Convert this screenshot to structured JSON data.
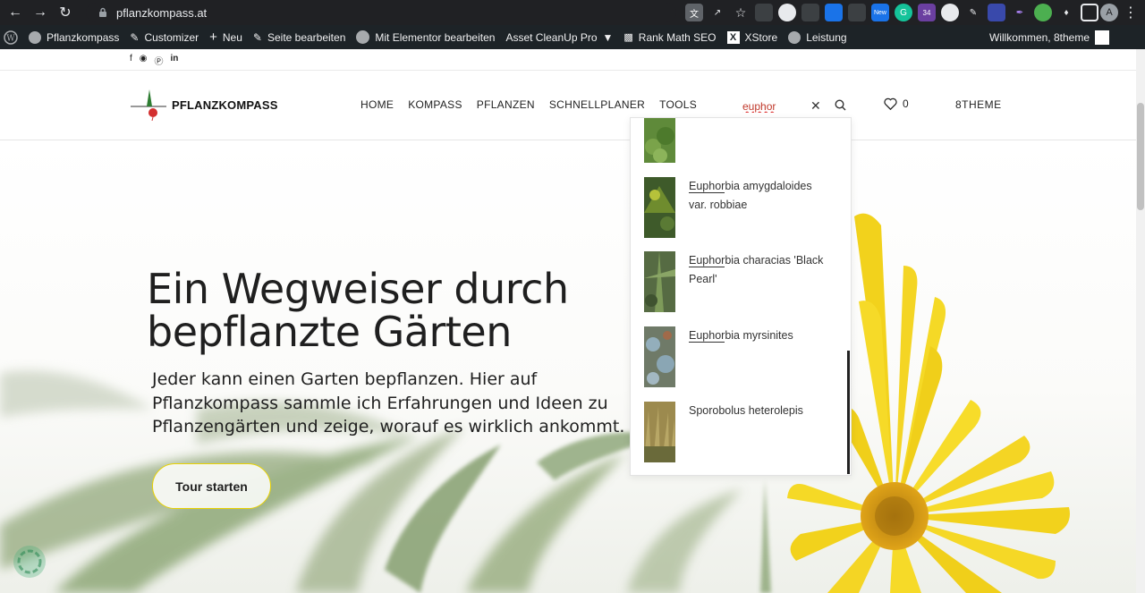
{
  "browser": {
    "url": "pflanzkompass.at",
    "profile_initial": "A",
    "ext_badge_new": "New",
    "ext_badge_count": "34"
  },
  "admin_bar": {
    "items": [
      {
        "label": "Pflanzkompass",
        "icon": "home-icon"
      },
      {
        "label": "Customizer",
        "icon": "brush-icon"
      },
      {
        "label": "Neu",
        "icon": "plus-icon"
      },
      {
        "label": "Seite bearbeiten",
        "icon": "pencil-icon"
      },
      {
        "label": "Mit Elementor bearbeiten",
        "icon": "elementor-icon"
      },
      {
        "label": "Asset CleanUp Pro",
        "icon": "funnel-icon"
      },
      {
        "label": "Rank Math SEO",
        "icon": "chart-icon"
      },
      {
        "label": "XStore",
        "icon": "xstore-icon"
      },
      {
        "label": "Leistung",
        "icon": "gauge-icon"
      }
    ],
    "welcome": "Willkommen, 8theme"
  },
  "header": {
    "logo_text": "PFLANZKOMPASS",
    "nav": [
      "HOME",
      "KOMPASS",
      "PFLANZEN",
      "SCHNELLPLANER",
      "TOOLS"
    ],
    "search_value": "euphor",
    "wishlist_count": "0",
    "account_label": "8THEME"
  },
  "hero": {
    "title": "Ein Wegweiser durch bepflanzte Gärten",
    "text": "Jeder kann einen Garten bepflanzen. Hier auf Pflanzkompass sammle ich Erfahrungen und Ideen zu Pflanzengärten und zeige, worauf es wirklich ankommt.",
    "button": "Tour starten"
  },
  "search_results": [
    {
      "match": "",
      "rest": ""
    },
    {
      "match": "Euphor",
      "rest": "bia amygdaloides var. robbiae"
    },
    {
      "match": "Euphor",
      "rest": "bia characias 'Black Pearl'"
    },
    {
      "match": "Euphor",
      "rest": "bia myrsinites"
    },
    {
      "match": "",
      "rest": "Sporobolus heterolepis"
    }
  ],
  "colors": {
    "accent_yellow": "#e9d200",
    "admin_bar": "#1d2327",
    "browser_bar": "#202124"
  }
}
